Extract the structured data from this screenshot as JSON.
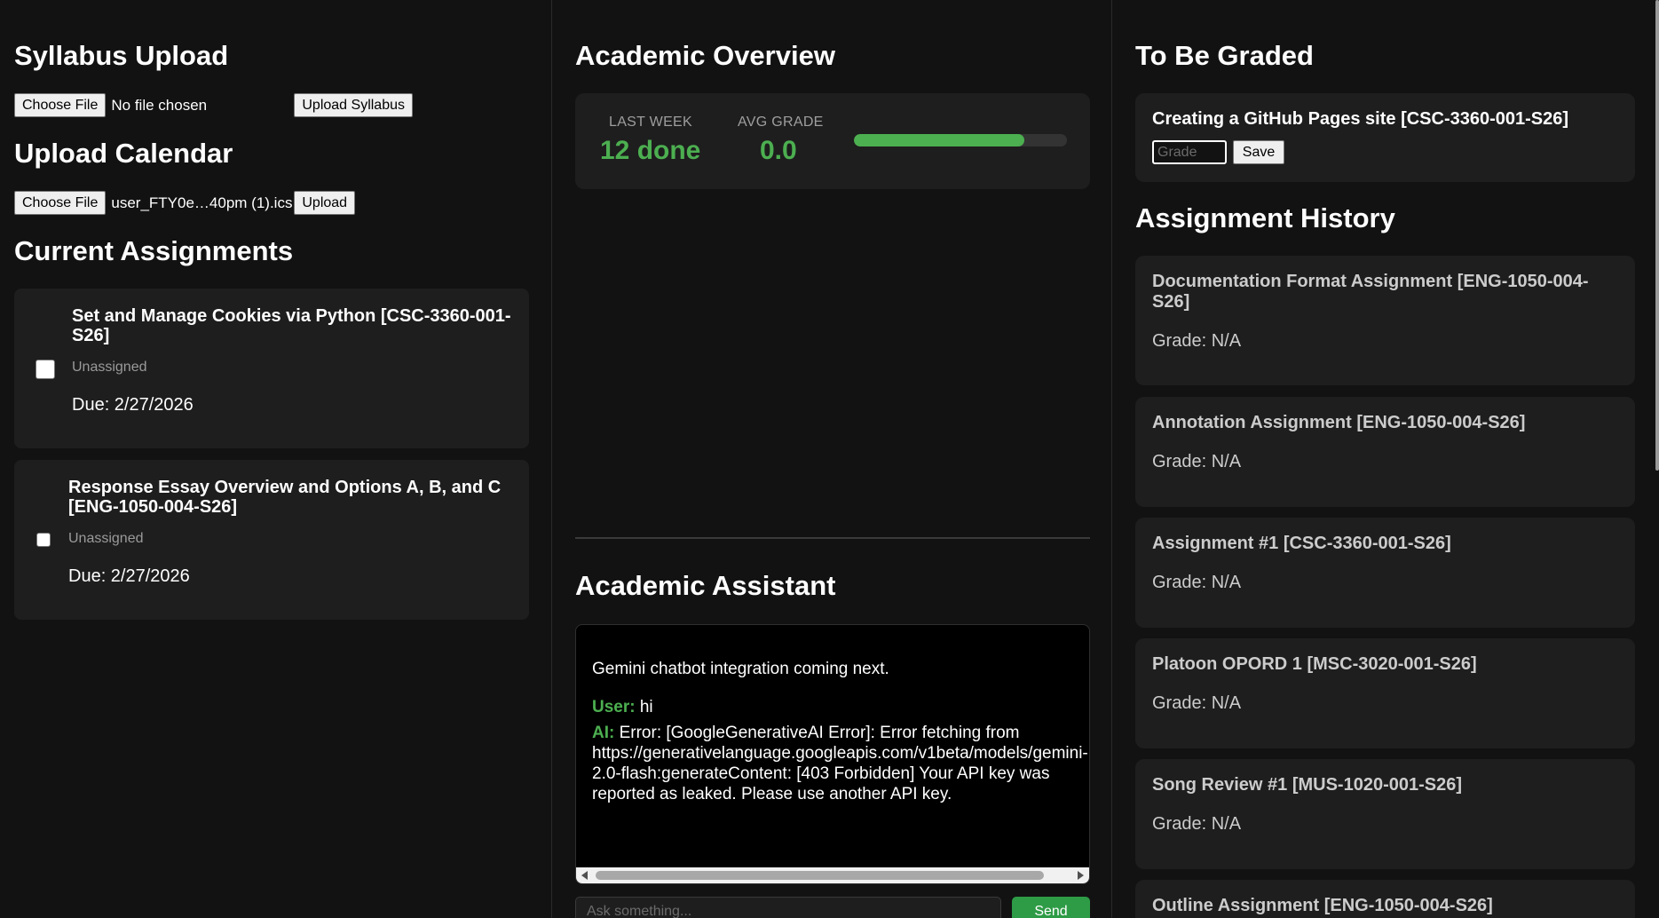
{
  "left": {
    "syllabus": {
      "heading": "Syllabus Upload",
      "choose_label": "Choose File",
      "file_status": "No file chosen",
      "upload_label": "Upload Syllabus"
    },
    "calendar": {
      "heading": "Upload Calendar",
      "choose_label": "Choose File",
      "file_status": "user_FTY0e…40pm (1).ics",
      "upload_label": "Upload"
    },
    "current": {
      "heading": "Current Assignments",
      "items": [
        {
          "title": "Set and Manage Cookies via Python [CSC-3360-001-S26]",
          "status": "Unassigned",
          "due": "Due: 2/27/2026"
        },
        {
          "title": "Response Essay Overview and Options A, B, and C [ENG-1050-004-S26]",
          "status": "Unassigned",
          "due": "Due: 2/27/2026"
        }
      ]
    }
  },
  "overview": {
    "heading": "Academic Overview",
    "last_week_label": "LAST WEEK",
    "last_week_value": "12 done",
    "avg_grade_label": "AVG GRADE",
    "avg_grade_value": "0.0",
    "progress_fraction": 0.8,
    "accent_color": "#4caf50"
  },
  "assistant": {
    "heading": "Academic Assistant",
    "intro": "Gemini chatbot integration coming next.",
    "messages": [
      {
        "who": "User:",
        "text": "hi"
      },
      {
        "who": "AI:",
        "text": "Error: [GoogleGenerativeAI Error]: Error fetching from https://generativelanguage.googleapis.com/v1beta/models/gemini-2.0-flash:generateContent: [403 Forbidden] Your API key was reported as leaked. Please use another API key."
      }
    ],
    "input_placeholder": "Ask something...",
    "send_label": "Send"
  },
  "right": {
    "to_grade": {
      "heading": "To Be Graded",
      "item_title": "Creating a GitHub Pages site [CSC-3360-001-S26]",
      "grade_placeholder": "Grade",
      "save_label": "Save"
    },
    "history": {
      "heading": "Assignment History",
      "items": [
        {
          "title": "Documentation Format Assignment [ENG-1050-004-S26]",
          "grade": "Grade: N/A"
        },
        {
          "title": "Annotation Assignment [ENG-1050-004-S26]",
          "grade": "Grade: N/A"
        },
        {
          "title": "Assignment #1 [CSC-3360-001-S26]",
          "grade": "Grade: N/A"
        },
        {
          "title": "Platoon OPORD 1 [MSC-3020-001-S26]",
          "grade": "Grade: N/A"
        },
        {
          "title": "Song Review #1 [MUS-1020-001-S26]",
          "grade": "Grade: N/A"
        },
        {
          "title": "Outline Assignment [ENG-1050-004-S26]",
          "grade": ""
        }
      ]
    }
  }
}
